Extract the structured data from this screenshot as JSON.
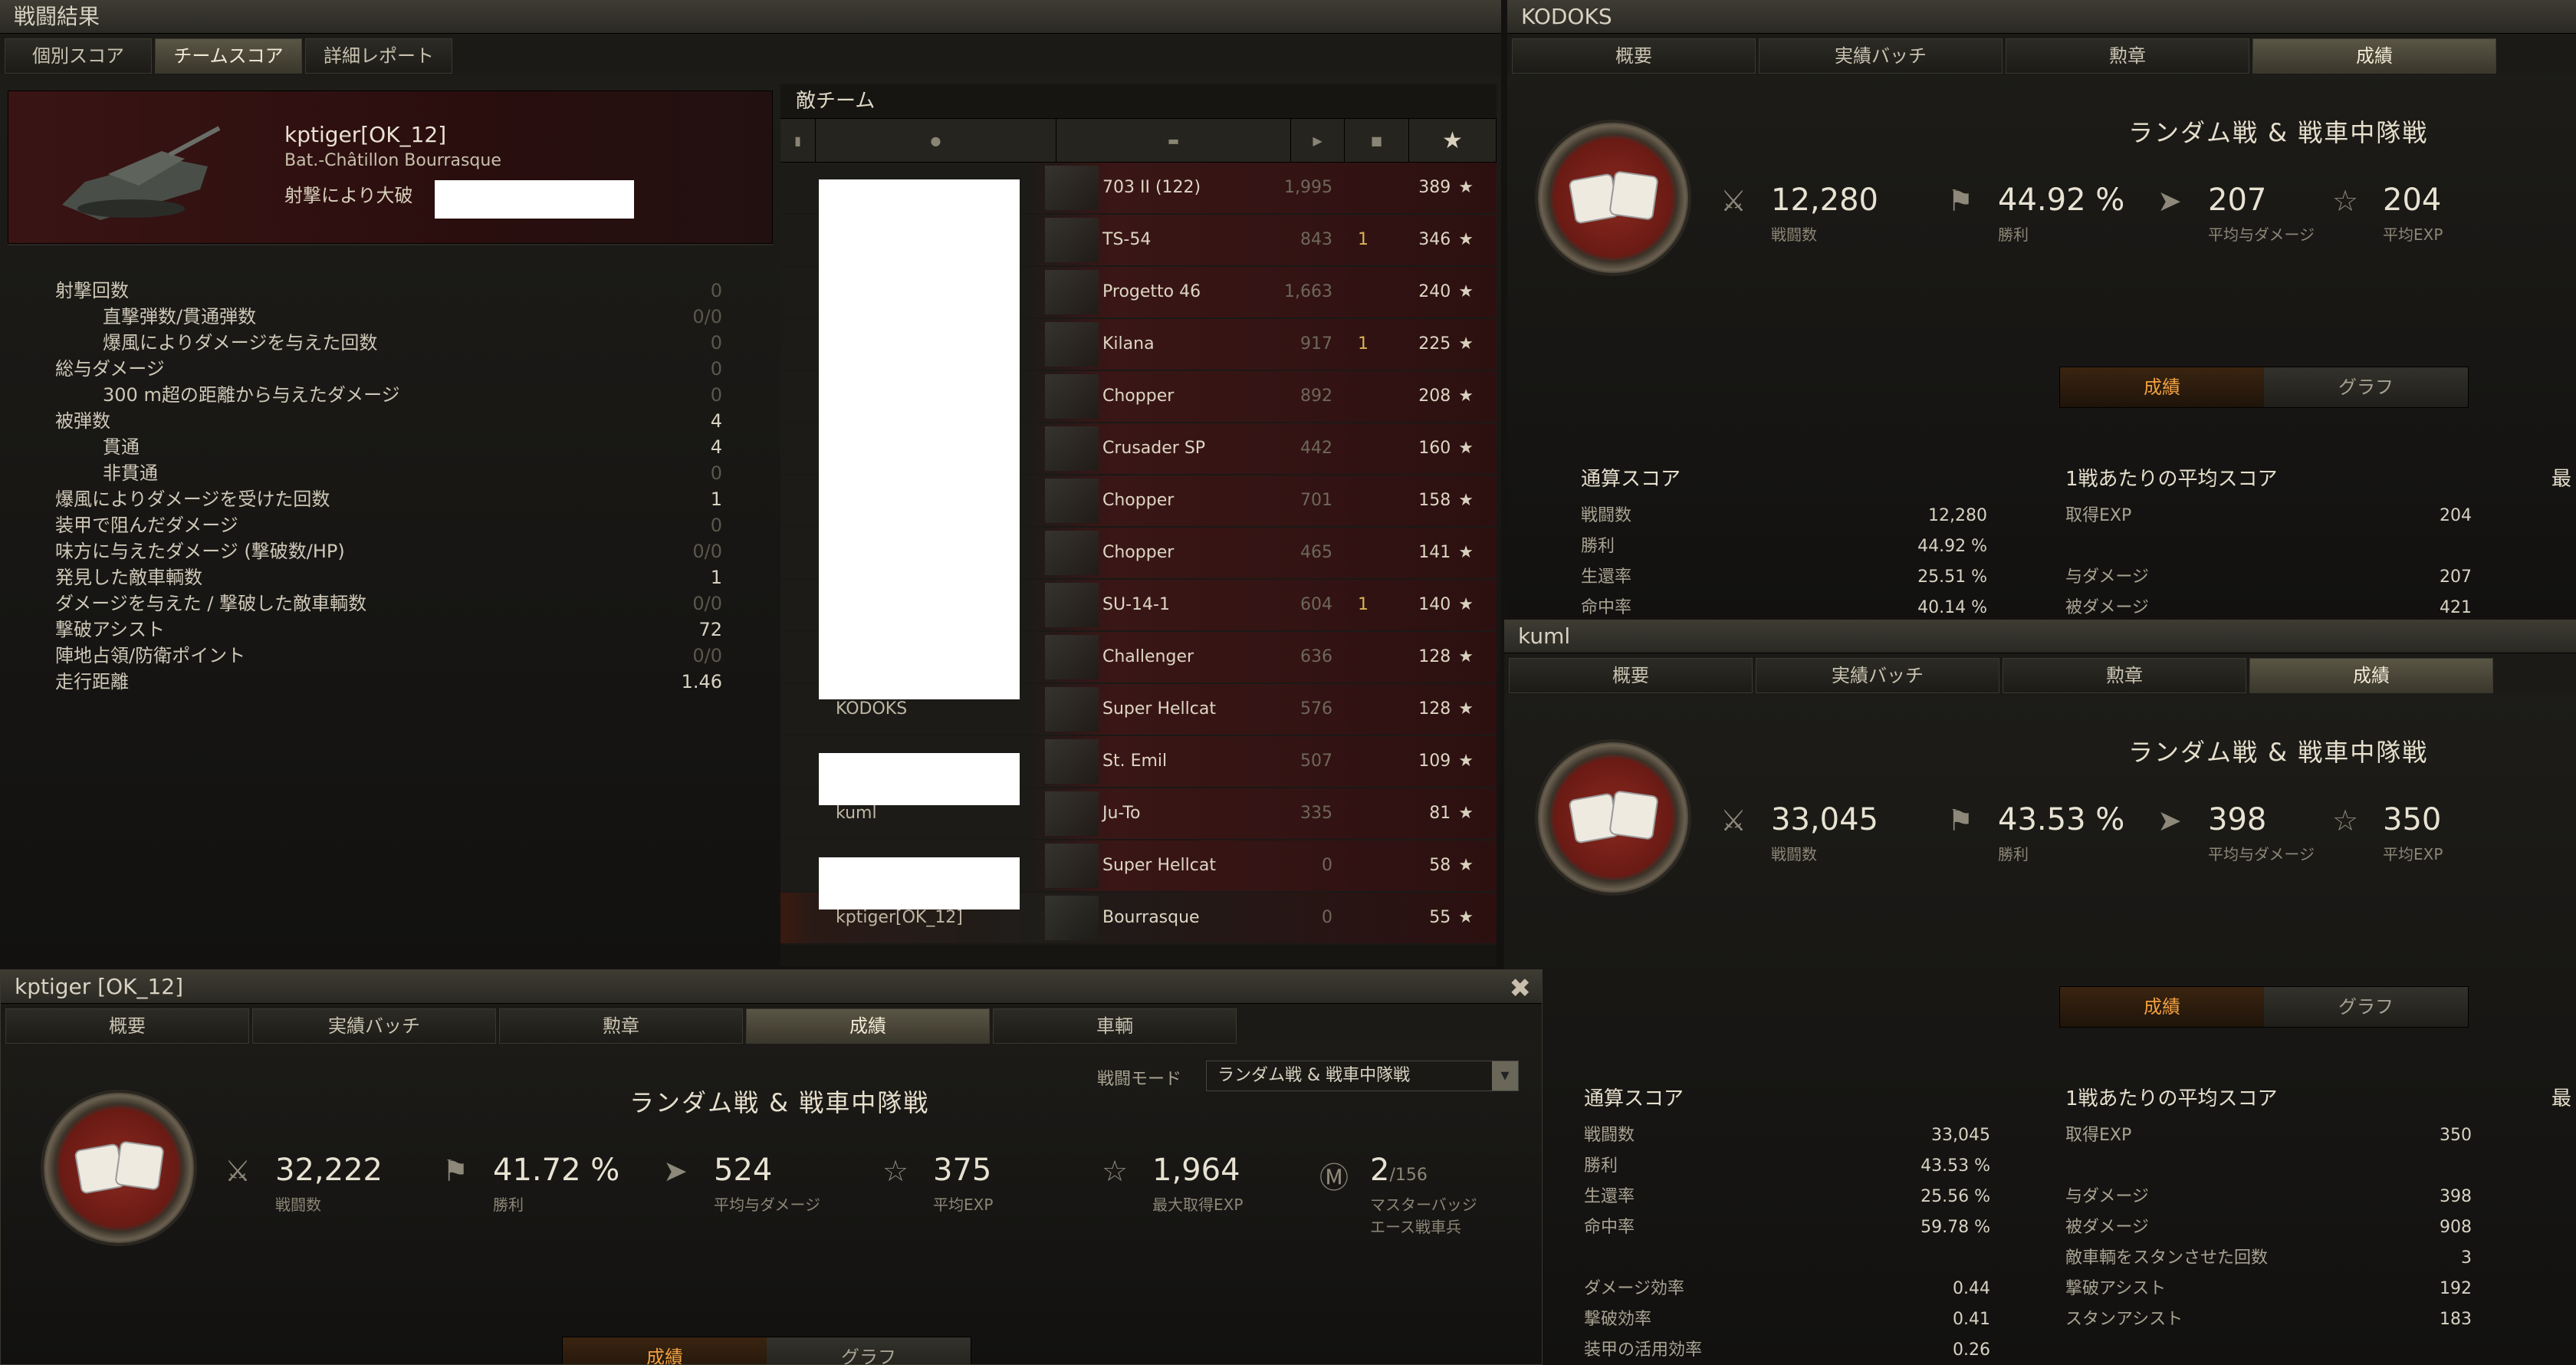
{
  "battle": {
    "title": "戦闘結果",
    "tabs": [
      "個別スコア",
      "チームスコア",
      "詳細レポート"
    ],
    "player": "kptiger[OK_12]",
    "tank": "Bat.-Châtillon Bourrasque",
    "death": "射撃により大破",
    "stats": [
      {
        "label": "射撃回数",
        "value": "0",
        "sub": false,
        "hi": false
      },
      {
        "label": "直撃弾数/貫通弾数",
        "value": "0/0",
        "sub": true,
        "hi": false
      },
      {
        "label": "爆風によりダメージを与えた回数",
        "value": "0",
        "sub": true,
        "hi": false
      },
      {
        "label": "総与ダメージ",
        "value": "0",
        "sub": false,
        "hi": false
      },
      {
        "label": "300 m超の距離から与えたダメージ",
        "value": "0",
        "sub": true,
        "hi": false
      },
      {
        "label": "被弾数",
        "value": "4",
        "sub": false,
        "hi": true
      },
      {
        "label": "貫通",
        "value": "4",
        "sub": true,
        "hi": true
      },
      {
        "label": "非貫通",
        "value": "0",
        "sub": true,
        "hi": false
      },
      {
        "label": "爆風によりダメージを受けた回数",
        "value": "1",
        "sub": false,
        "hi": true
      },
      {
        "label": "装甲で阻んだダメージ",
        "value": "0",
        "sub": false,
        "hi": false
      },
      {
        "label": "味方に与えたダメージ (撃破数/HP)",
        "value": "0/0",
        "sub": false,
        "hi": false
      },
      {
        "label": "発見した敵車輌数",
        "value": "1",
        "sub": false,
        "hi": true
      },
      {
        "label": "ダメージを与えた / 撃破した敵車輌数",
        "value": "0/0",
        "sub": false,
        "hi": false
      },
      {
        "label": "撃破アシスト",
        "value": "72",
        "sub": false,
        "hi": true
      },
      {
        "label": "陣地占領/防衛ポイント",
        "value": "0/0",
        "sub": false,
        "hi": false
      },
      {
        "label": "走行距離",
        "value": "1.46",
        "sub": false,
        "hi": true
      }
    ]
  },
  "enemy": {
    "title": "敵チーム",
    "rows": [
      {
        "player": "",
        "tank": "703 II (122)",
        "damage": "1,995",
        "kills": "",
        "xp": "389"
      },
      {
        "player": "",
        "tank": "TS-54",
        "damage": "843",
        "kills": "1",
        "xp": "346"
      },
      {
        "player": "",
        "tank": "Progetto 46",
        "damage": "1,663",
        "kills": "",
        "xp": "240"
      },
      {
        "player": "",
        "tank": "Kilana",
        "damage": "917",
        "kills": "1",
        "xp": "225"
      },
      {
        "player": "",
        "tank": "Chopper",
        "damage": "892",
        "kills": "",
        "xp": "208"
      },
      {
        "player": "",
        "tank": "Crusader SP",
        "damage": "442",
        "kills": "",
        "xp": "160"
      },
      {
        "player": "",
        "tank": "Chopper",
        "damage": "701",
        "kills": "",
        "xp": "158"
      },
      {
        "player": "",
        "tank": "Chopper",
        "damage": "465",
        "kills": "",
        "xp": "141"
      },
      {
        "player": "",
        "tank": "SU-14-1",
        "damage": "604",
        "kills": "1",
        "xp": "140"
      },
      {
        "player": "",
        "tank": "Challenger",
        "damage": "636",
        "kills": "",
        "xp": "128"
      },
      {
        "player": "KODOKS",
        "tank": "Super Hellcat",
        "damage": "576",
        "kills": "",
        "xp": "128"
      },
      {
        "player": "",
        "tank": "St. Emil",
        "damage": "507",
        "kills": "",
        "xp": "109"
      },
      {
        "player": "kuml",
        "tank": "Ju-To",
        "damage": "335",
        "kills": "",
        "xp": "81"
      },
      {
        "player": "",
        "tank": "Super Hellcat",
        "damage": "0",
        "kills": "",
        "xp": "58"
      },
      {
        "player": "kptiger[OK_12]",
        "tank": "Bourrasque",
        "damage": "0",
        "kills": "",
        "xp": "55"
      }
    ]
  },
  "profileTabs": [
    "概要",
    "実績バッチ",
    "勲章",
    "成績"
  ],
  "modeTitle": "ランダム戦 & 戦車中隊戦",
  "toggle": [
    "成績",
    "グラフ"
  ],
  "statLabels": {
    "battles": "戦闘数",
    "wins": "勝利",
    "avgdmg": "平均与ダメージ",
    "avgxp": "平均EXP"
  },
  "kodoks": {
    "title": "KODOKS",
    "battles": "12,280",
    "wins": "44.92 %",
    "avgdmg": "207",
    "avgxp": "204",
    "totalHeader": "通算スコア",
    "total": [
      {
        "l": "戦闘数",
        "v": "12,280"
      },
      {
        "l": "勝利",
        "v": "44.92 %"
      },
      {
        "l": "生還率",
        "v": "25.51 %"
      },
      {
        "l": "命中率",
        "v": "40.14 %"
      }
    ],
    "avgHeader": "1戦あたりの平均スコア",
    "avg": [
      {
        "l": "取得EXP",
        "v": "204"
      },
      {
        "l": "",
        "v": ""
      },
      {
        "l": "与ダメージ",
        "v": "207"
      },
      {
        "l": "被ダメージ",
        "v": "421"
      }
    ],
    "third": "最"
  },
  "kuml": {
    "title": "kuml",
    "battles": "33,045",
    "wins": "43.53 %",
    "avgdmg": "398",
    "avgxp": "350",
    "totalHeader": "通算スコア",
    "total": [
      {
        "l": "戦闘数",
        "v": "33,045"
      },
      {
        "l": "勝利",
        "v": "43.53 %"
      },
      {
        "l": "生還率",
        "v": "25.56 %"
      },
      {
        "l": "命中率",
        "v": "59.78 %"
      },
      {
        "l": "",
        "v": ""
      },
      {
        "l": "ダメージ効率",
        "v": "0.44"
      },
      {
        "l": "撃破効率",
        "v": "0.41"
      },
      {
        "l": "装甲の活用効率",
        "v": "0.26"
      }
    ],
    "avgHeader": "1戦あたりの平均スコア",
    "avg": [
      {
        "l": "取得EXP",
        "v": "350"
      },
      {
        "l": "",
        "v": ""
      },
      {
        "l": "与ダメージ",
        "v": "398"
      },
      {
        "l": "被ダメージ",
        "v": "908"
      },
      {
        "l": "敵車輌をスタンさせた回数",
        "v": "3"
      },
      {
        "l": "撃破アシスト",
        "v": "192"
      },
      {
        "l": "スタンアシスト",
        "v": "183"
      }
    ],
    "third": "最"
  },
  "kptiger": {
    "title": "kptiger [OK_12]",
    "tabs": [
      "概要",
      "実績バッチ",
      "勲章",
      "成績",
      "車輌"
    ],
    "modeLabel": "戦闘モード",
    "modeValue": "ランダム戦 & 戦車中隊戦",
    "battles": "32,222",
    "wins": "41.72 %",
    "avgdmg": "524",
    "avgxp": "375",
    "maxxp": "1,964",
    "maxxpLabel": "最大取得EXP",
    "mastery": "2",
    "masteryTotal": "/156",
    "masteryLabel1": "マスターバッジ",
    "masteryLabel2": "エース戦車兵"
  }
}
